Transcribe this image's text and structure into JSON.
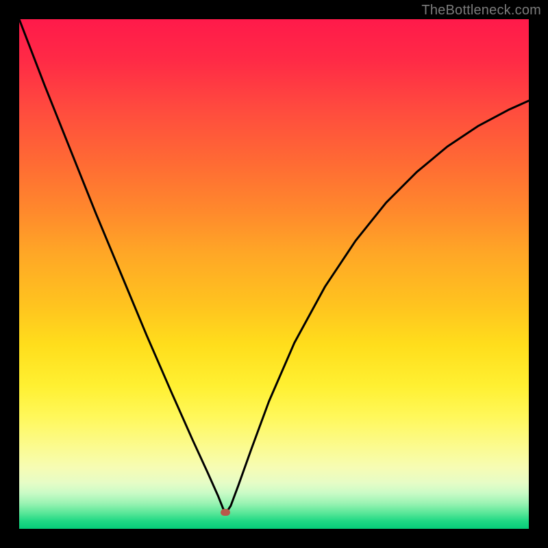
{
  "watermark": "TheBottleneck.com",
  "marker": {
    "x_frac": 0.405,
    "y_frac": 0.968
  },
  "chart_data": {
    "type": "line",
    "title": "",
    "xlabel": "",
    "ylabel": "",
    "xlim": [
      0,
      1
    ],
    "ylim": [
      0,
      1
    ],
    "note": "Axes have no visible tick labels; x and y are normalized fractions of the plot area (y=1 is top, y=0 is bottom). The curve is a V-shaped bottleneck curve with its minimum near x≈0.405.",
    "series": [
      {
        "name": "bottleneck-curve",
        "x": [
          0.0,
          0.05,
          0.1,
          0.15,
          0.2,
          0.25,
          0.3,
          0.34,
          0.37,
          0.39,
          0.4,
          0.405,
          0.415,
          0.43,
          0.455,
          0.49,
          0.54,
          0.6,
          0.66,
          0.72,
          0.78,
          0.84,
          0.9,
          0.96,
          1.0
        ],
        "y": [
          1.0,
          0.87,
          0.745,
          0.62,
          0.5,
          0.38,
          0.265,
          0.175,
          0.11,
          0.065,
          0.04,
          0.03,
          0.045,
          0.085,
          0.155,
          0.25,
          0.365,
          0.475,
          0.565,
          0.64,
          0.7,
          0.75,
          0.79,
          0.822,
          0.84
        ]
      }
    ],
    "marker_point": {
      "x": 0.405,
      "y": 0.032
    },
    "background_gradient": {
      "top_color": "#ff1a4a",
      "mid_color": "#ffde1c",
      "bottom_color": "#06cd79"
    }
  }
}
